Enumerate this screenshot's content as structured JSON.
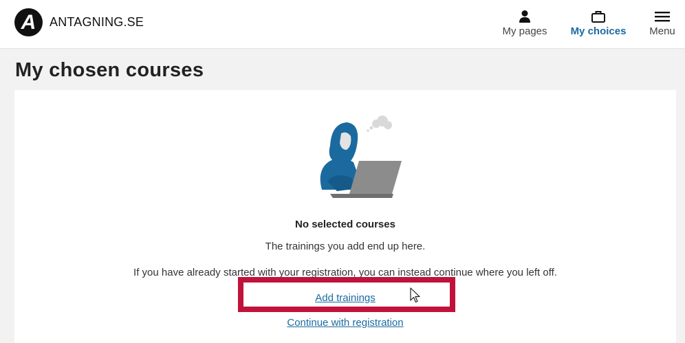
{
  "header": {
    "logo_letter": "A",
    "logo_text": "ANTAGNING.SE",
    "nav": {
      "my_pages": "My pages",
      "my_choices": "My choices",
      "menu": "Menu"
    }
  },
  "page": {
    "title": "My chosen courses"
  },
  "empty_state": {
    "title": "No selected courses",
    "text": "The trainings you add end up here.",
    "text2": "If you have already started with your registration, you can instead continue where you left off.",
    "add_link": "Add trainings",
    "continue_link": "Continue with registration"
  },
  "colors": {
    "accent": "#1a6aa0",
    "highlight": "#c0133b",
    "background": "#f2f2f2"
  },
  "icons": {
    "my_pages": "person-icon",
    "my_choices": "briefcase-icon",
    "menu": "hamburger-menu-icon"
  }
}
